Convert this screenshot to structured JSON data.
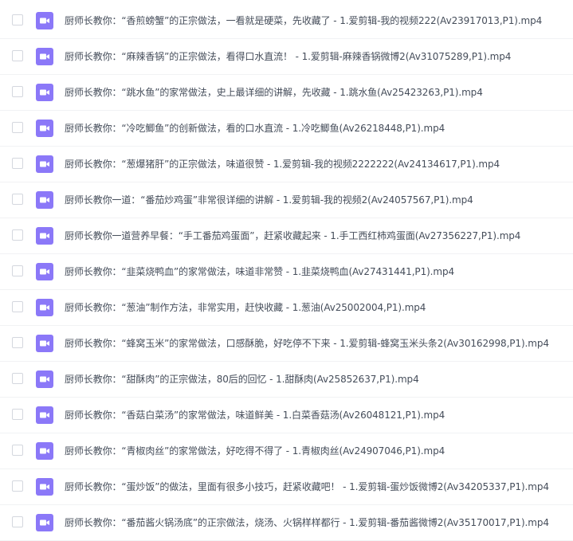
{
  "file_list": {
    "icon": "video-file-icon",
    "icon_color": "#8b78f8",
    "items": [
      {
        "name": "厨师长教你：“香煎螃蟹”的正宗做法，一看就是硬菜，先收藏了 - 1.爱剪辑-我的视频222(Av23917013,P1).mp4"
      },
      {
        "name": "厨师长教你：“麻辣香锅”的正宗做法，看得口水直流！ - 1.爱剪辑-麻辣香锅微博2(Av31075289,P1).mp4"
      },
      {
        "name": "厨师长教你：“跳水鱼”的家常做法，史上最详细的讲解，先收藏 - 1.跳水鱼(Av25423263,P1).mp4"
      },
      {
        "name": "厨师长教你：“冷吃鲫鱼”的创新做法，看的口水直流 - 1.冷吃鲫鱼(Av26218448,P1).mp4"
      },
      {
        "name": "厨师长教你：“葱爆猪肝”的正宗做法，味道很赞 - 1.爱剪辑-我的视频2222222(Av24134617,P1).mp4"
      },
      {
        "name": "厨师长教你一道：“番茄炒鸡蛋”非常很详细的讲解 - 1.爱剪辑-我的视频2(Av24057567,P1).mp4"
      },
      {
        "name": "厨师长教你一道营养早餐：“手工番茄鸡蛋面”，赶紧收藏起来 - 1.手工西红柿鸡蛋面(Av27356227,P1).mp4"
      },
      {
        "name": "厨师长教你：“韭菜烧鸭血”的家常做法，味道非常赞 - 1.韭菜烧鸭血(Av27431441,P1).mp4"
      },
      {
        "name": "厨师长教你：“葱油”制作方法，非常实用，赶快收藏 - 1.葱油(Av25002004,P1).mp4"
      },
      {
        "name": "厨师长教你：“蜂窝玉米”的家常做法，口感酥脆，好吃停不下来 - 1.爱剪辑-蜂窝玉米头条2(Av30162998,P1).mp4"
      },
      {
        "name": "厨师长教你：“甜酥肉”的正宗做法，80后的回忆 - 1.甜酥肉(Av25852637,P1).mp4"
      },
      {
        "name": "厨师长教你：“香菇白菜汤”的家常做法，味道鲜美 - 1.白菜香菇汤(Av26048121,P1).mp4"
      },
      {
        "name": "厨师长教你：“青椒肉丝”的家常做法，好吃得不得了 - 1.青椒肉丝(Av24907046,P1).mp4"
      },
      {
        "name": "厨师长教你：“蛋炒饭”的做法，里面有很多小技巧，赶紧收藏吧！ - 1.爱剪辑-蛋炒饭微博2(Av34205337,P1).mp4"
      },
      {
        "name": "厨师长教你：“番茄酱火锅汤底”的正宗做法，烧汤、火锅样样都行 - 1.爱剪辑-番茄酱微博2(Av35170017,P1).mp4"
      }
    ]
  }
}
